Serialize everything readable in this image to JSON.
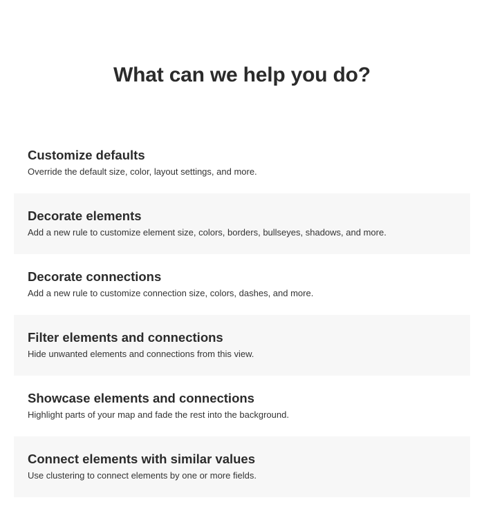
{
  "heading": "What can we help you do?",
  "options": [
    {
      "title": "Customize defaults",
      "description": "Override the default size, color, layout settings, and more."
    },
    {
      "title": "Decorate elements",
      "description": "Add a new rule to customize element size, colors, borders, bullseyes, shadows, and more."
    },
    {
      "title": "Decorate connections",
      "description": "Add a new rule to customize connection size, colors, dashes, and more."
    },
    {
      "title": "Filter elements and connections",
      "description": "Hide unwanted elements and connections from this view."
    },
    {
      "title": "Showcase elements and connections",
      "description": "Highlight parts of your map and fade the rest into the background."
    },
    {
      "title": "Connect elements with similar values",
      "description": "Use clustering to connect elements by one or more fields."
    }
  ]
}
